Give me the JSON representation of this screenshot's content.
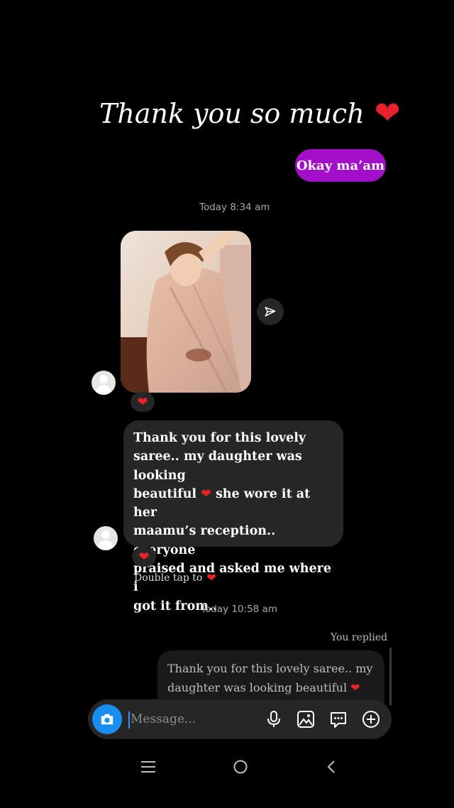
{
  "headline": {
    "text": "Thank you so much",
    "heart": "❤"
  },
  "sent_message": {
    "text": "Okay ma’am"
  },
  "timestamps": [
    "Today 8:34 am",
    "Today 10:58 am"
  ],
  "photo_message": {
    "icon": "send-icon",
    "reaction": "❤"
  },
  "received_message": {
    "lines": [
      "Thank you for this lovely",
      "saree.. my daughter was looking",
      "beautiful",
      "she wore it at her",
      "maamu’s reception.. everyone",
      "praised and asked me where i",
      "got it from.."
    ],
    "heart": "❤",
    "reaction": "❤"
  },
  "hint": {
    "text": "Double tap to",
    "heart": "❤"
  },
  "reply": {
    "label": "You replied",
    "quote_line1": "Thank you for this lovely saree.. my",
    "quote_line2": "daughter was looking beautiful",
    "heart": "❤"
  },
  "composer": {
    "placeholder": "Message...",
    "icons": [
      "camera-icon",
      "microphone-icon",
      "gallery-icon",
      "sticker-icon",
      "add-icon"
    ],
    "accent": "#1a8df0"
  },
  "navbar": {
    "icons": [
      "recent-apps-icon",
      "home-icon",
      "back-icon"
    ]
  },
  "colors": {
    "sent_bubble": "#a10fc9",
    "received_bubble": "#262626",
    "heart": "#e8232b",
    "background": "#000000"
  }
}
